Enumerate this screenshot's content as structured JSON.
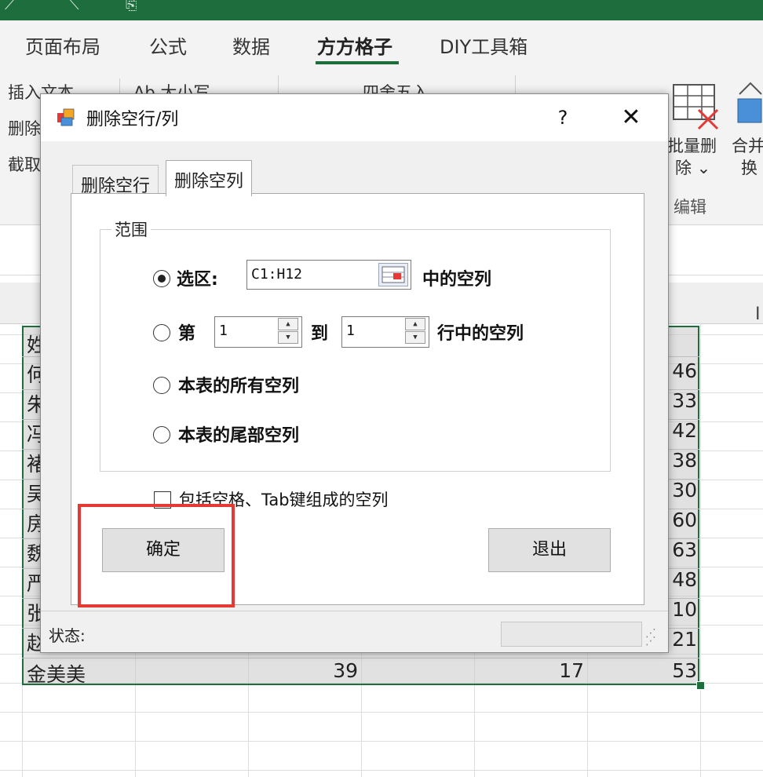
{
  "excel": {
    "ribbon_tabs": [
      "页面布局",
      "公式",
      "数据",
      "方方格子",
      "DIY工具箱"
    ],
    "active_tab": "方方格子",
    "ribbon_left_items": [
      "插入文本 ⌄",
      "删除",
      "截取"
    ],
    "ribbon_mid_items": [
      "Ab 大小写 ⌄",
      "四舍五入 ⌄"
    ],
    "ribbon_right_items": [
      "批量删",
      "除 ⌄",
      "合并",
      "换",
      "编辑"
    ],
    "col_header_right": "I",
    "rows": [
      {
        "left": "姓",
        "right": ""
      },
      {
        "left": "何",
        "right": "46"
      },
      {
        "left": "朱",
        "right": "33"
      },
      {
        "left": "冯",
        "right": "42"
      },
      {
        "left": "褚",
        "right": "38"
      },
      {
        "left": "吴",
        "right": "30"
      },
      {
        "left": "房",
        "right": "60"
      },
      {
        "left": "魏",
        "right": "63"
      },
      {
        "left": "严",
        "right": "48"
      },
      {
        "left": "张",
        "right": "10"
      },
      {
        "left": "赵",
        "right": "21"
      },
      {
        "left": "金美美",
        "right": "53"
      }
    ],
    "last_row_values": [
      "39",
      "17"
    ]
  },
  "dialog": {
    "title": "删除空行/列",
    "help": "?",
    "close": "✕",
    "tabs": [
      "删除空行",
      "删除空列"
    ],
    "active_tab": "删除空列",
    "group_label": "范围",
    "option_selection_label": "选区:",
    "selection_value": "C1:H12",
    "selection_suffix": "中的空列",
    "option_rows_prefix": "第",
    "rows_from": "1",
    "rows_to_label": "到",
    "rows_to": "1",
    "rows_suffix": "行中的空列",
    "option_all": "本表的所有空列",
    "option_tail": "本表的尾部空列",
    "selected_option": "selection",
    "checkbox_label": "包括空格、Tab键组成的空列",
    "checkbox_checked": false,
    "ok_label": "确定",
    "exit_label": "退出",
    "status_label": "状态:",
    "highlight_color": "#e53935"
  }
}
